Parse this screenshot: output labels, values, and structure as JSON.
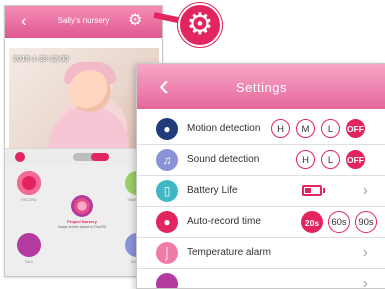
{
  "nursery": {
    "title": "Sally's nursery",
    "timestamp": "2015-1-28-12:00",
    "buttons": {
      "record": "RECORD",
      "snapshot": "SNAPSHOT",
      "talk": "TALK",
      "sound": "SOUND"
    },
    "brand": "Project Nursery",
    "note": "Swipe screen above to Pan/Tilt"
  },
  "settings": {
    "title": "Settings",
    "rows": [
      {
        "label": "Motion detection",
        "options": [
          "H",
          "M",
          "L",
          "OFF"
        ],
        "selected": "OFF"
      },
      {
        "label": "Sound detection",
        "options": [
          "H",
          "L",
          "OFF"
        ],
        "selected": "OFF"
      },
      {
        "label": "Battery Life",
        "battery_level": 0.45
      },
      {
        "label": "Auto-record time",
        "options": [
          "20s",
          "60s",
          "90s"
        ],
        "selected": "20s"
      },
      {
        "label": "Temperature alarm"
      }
    ]
  },
  "colors": {
    "accent": "#e2245f",
    "header": "#e6679d",
    "motion_icon": "#1f3b7a",
    "sound_icon": "#8b93d8",
    "battery_icon": "#3fb7c4",
    "record_icon": "#e2245f",
    "temperature_icon": "#f07aa8"
  }
}
